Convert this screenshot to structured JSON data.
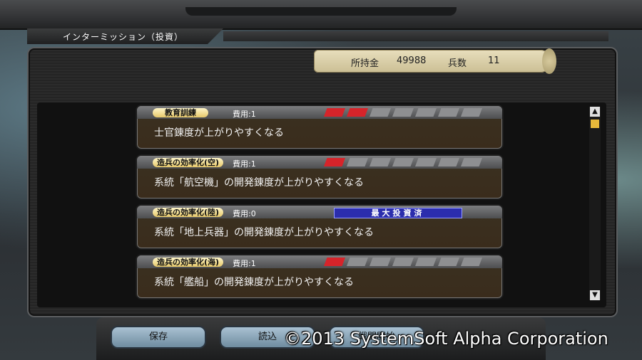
{
  "window_title": "インターミッション（投資）",
  "status": {
    "funds_label": "所持金",
    "funds_value": "49988",
    "soldiers_label": "兵数",
    "soldiers_value": "11"
  },
  "investments": [
    {
      "badge": "教育訓練",
      "cost": "費用:1",
      "level": 2,
      "max_level": 7,
      "maxed": false,
      "description": "士官錬度が上がりやすくなる"
    },
    {
      "badge": "造兵の効率化(空)",
      "cost": "費用:1",
      "level": 1,
      "max_level": 7,
      "maxed": false,
      "description": "系統「航空機」の開発錬度が上がりやすくなる"
    },
    {
      "badge": "造兵の効率化(陸)",
      "cost": "費用:0",
      "level": 7,
      "max_level": 7,
      "maxed": true,
      "maxed_label": "最大投資済",
      "description": "系統「地上兵器」の開発錬度が上がりやすくなる"
    },
    {
      "badge": "造兵の効率化(海)",
      "cost": "費用:1",
      "level": 1,
      "max_level": 7,
      "maxed": false,
      "description": "系統「艦船」の開発錬度が上がりやすくなる"
    }
  ],
  "buttons": {
    "save": "保存",
    "load": "読込",
    "third": "戦闘開始"
  },
  "copyright": "©2013 SystemSoft Alpha Corporation",
  "colors": {
    "gauge_on": "#d6242a",
    "gauge_off": "#8e8f91",
    "maxed_bar": "#2b2dad"
  }
}
